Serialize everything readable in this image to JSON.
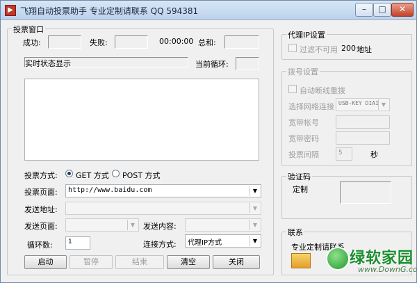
{
  "window": {
    "title": "飞翔自动投票助手 专业定制请联系 QQ 594381",
    "min_glyph": "–",
    "max_glyph": "□",
    "close_glyph": "✕"
  },
  "vote_window": {
    "group_title": "投票窗口",
    "success_label": "成功:",
    "fail_label": "失败:",
    "time_value": "00:00:00",
    "total_label": "总和:",
    "status_text": "实时状态显示",
    "current_loop_label": "当前循环:",
    "method_label": "投票方式:",
    "method_get": "GET 方式",
    "method_post": "POST 方式",
    "page_label": "投票页面:",
    "page_value": "http://www.baidu.com",
    "send_addr_label": "发送地址:",
    "send_page_label": "发送页面:",
    "send_content_label": "发送内容:",
    "loop_count_label": "循环数:",
    "loop_count_value": "1",
    "connect_label": "连接方式:",
    "connect_value": "代理IP方式"
  },
  "buttons": {
    "start": "启动",
    "pause": "暂停",
    "stop": "结束",
    "clear": "清空",
    "close": "关闭"
  },
  "proxy": {
    "group_title": "代理IP设置",
    "filter_label": "过滤不可用",
    "count_value": "200",
    "count_unit": "地址"
  },
  "dial": {
    "group_title": "拨号设置",
    "auto_redial_label": "自动断线重拨",
    "network_label": "选择网络连接",
    "network_value": "USB-KEY DIAI",
    "account_label": "宽带帐号",
    "password_label": "宽带密码",
    "interval_label": "投票间隔",
    "interval_value": "5",
    "interval_unit": "秒"
  },
  "captcha": {
    "group_title": "验证码",
    "custom_label": "定制"
  },
  "contact": {
    "group_title": "联系",
    "text": "专业定制请联系"
  },
  "watermark": {
    "brand": "绿软家园",
    "url": "www.DownG.com"
  }
}
